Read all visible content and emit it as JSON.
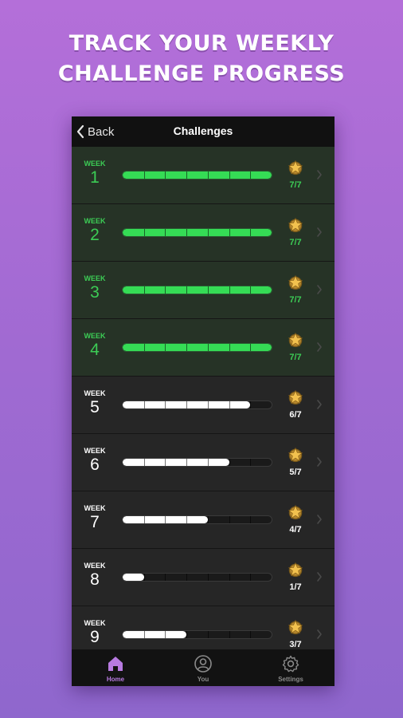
{
  "headline": {
    "line1": "TRACK YOUR WEEKLY",
    "line2": "CHALLENGE PROGRESS"
  },
  "topbar": {
    "back_label": "Back",
    "title": "Challenges"
  },
  "weeks": [
    {
      "label": "WEEK",
      "number": "1",
      "score": "7/7",
      "completed": 7,
      "total": 7
    },
    {
      "label": "WEEK",
      "number": "2",
      "score": "7/7",
      "completed": 7,
      "total": 7
    },
    {
      "label": "WEEK",
      "number": "3",
      "score": "7/7",
      "completed": 7,
      "total": 7
    },
    {
      "label": "WEEK",
      "number": "4",
      "score": "7/7",
      "completed": 7,
      "total": 7
    },
    {
      "label": "WEEK",
      "number": "5",
      "score": "6/7",
      "completed": 6,
      "total": 7
    },
    {
      "label": "WEEK",
      "number": "6",
      "score": "5/7",
      "completed": 5,
      "total": 7
    },
    {
      "label": "WEEK",
      "number": "7",
      "score": "4/7",
      "completed": 4,
      "total": 7
    },
    {
      "label": "WEEK",
      "number": "8",
      "score": "1/7",
      "completed": 1,
      "total": 7
    },
    {
      "label": "WEEK",
      "number": "9",
      "score": "3/7",
      "completed": 3,
      "total": 7
    }
  ],
  "tabs": [
    {
      "label": "Home",
      "icon": "home-icon",
      "active": true
    },
    {
      "label": "You",
      "icon": "profile-icon",
      "active": false
    },
    {
      "label": "Settings",
      "icon": "gear-icon",
      "active": false
    }
  ],
  "colors": {
    "background_top": "#b46fd9",
    "background_bottom": "#8f67cd",
    "complete_green": "#35dc55",
    "progress_white": "#ffffff",
    "active_tab": "#b77ae0",
    "star_gold": "#f2c14e"
  }
}
